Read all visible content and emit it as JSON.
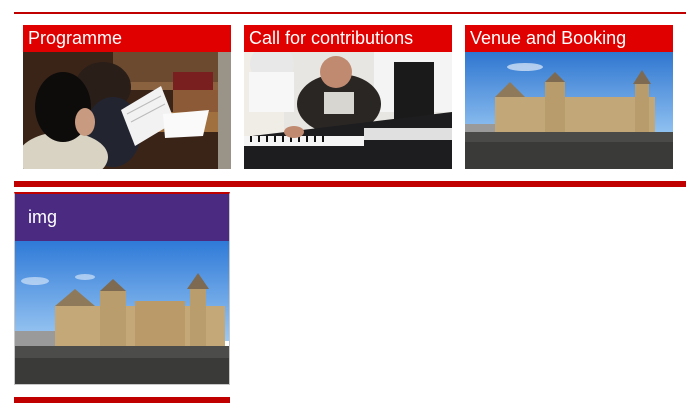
{
  "tiles": [
    {
      "label": "Programme",
      "photo": "students-reading-photo"
    },
    {
      "label": "Call for contributions",
      "photo": "music-keyboard-photo"
    },
    {
      "label": "Venue and Booking",
      "photo": "old-college-building-photo"
    }
  ],
  "card": {
    "label": "img",
    "photo": "old-college-building-photo"
  },
  "colors": {
    "tile_header": "#e00000",
    "rule": "#c00000",
    "card_header": "#4b2a82"
  }
}
